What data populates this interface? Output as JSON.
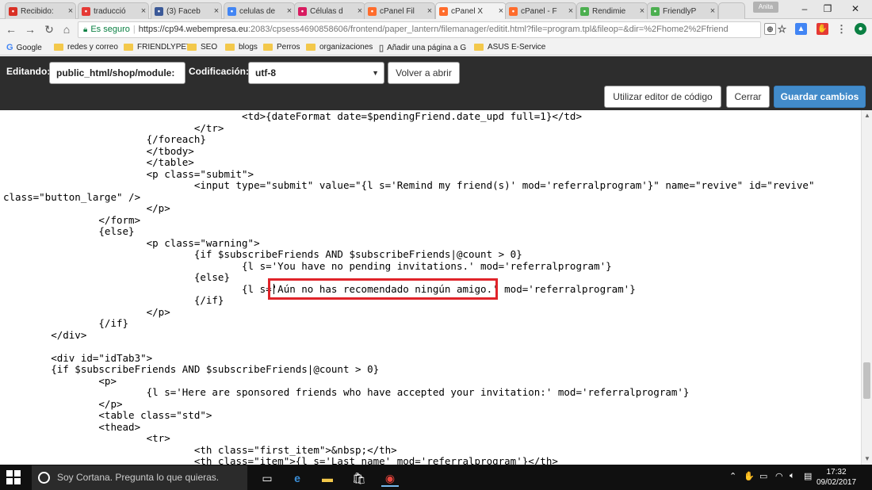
{
  "browser": {
    "tabs": [
      {
        "title": "Recibido:",
        "favicon": "gmail-icon",
        "color": "#d93025"
      },
      {
        "title": "traducció",
        "favicon": "w-icon",
        "color": "#e53935"
      },
      {
        "title": "(3) Faceb",
        "favicon": "facebook-icon",
        "color": "#3b5998"
      },
      {
        "title": "celulas de",
        "favicon": "google-icon",
        "color": "#4285f4"
      },
      {
        "title": "Células d",
        "favicon": "question-icon",
        "color": "#d81b60"
      },
      {
        "title": "cPanel Fil",
        "favicon": "cpanel-icon",
        "color": "#ff6c2c"
      },
      {
        "title": "cPanel X",
        "favicon": "cpanel-icon",
        "color": "#ff6c2c"
      },
      {
        "title": "cPanel - F",
        "favicon": "cpanel-icon",
        "color": "#ff6c2c"
      },
      {
        "title": "Rendimie",
        "favicon": "image-icon",
        "color": "#4caf50"
      },
      {
        "title": "FriendlyP",
        "favicon": "image-icon",
        "color": "#4caf50"
      }
    ],
    "profile": "Anita",
    "secure_label": "Es seguro",
    "url_host": "https://cp94.webempresa.eu",
    "url_rest": ":2083/cpsess4690858606/frontend/paper_lantern/filemanager/editit.html?file=program.tpl&fileop=&dir=%2Fhome2%2Ffriend"
  },
  "bookmarks": [
    {
      "label": "Google",
      "icon": "google-icon"
    },
    {
      "label": "redes y correo",
      "icon": "folder-icon"
    },
    {
      "label": "FRIENDLYPET",
      "icon": "folder-icon"
    },
    {
      "label": "SEO",
      "icon": "folder-icon"
    },
    {
      "label": "blogs",
      "icon": "folder-icon"
    },
    {
      "label": "Perros",
      "icon": "folder-icon"
    },
    {
      "label": "organizaciones",
      "icon": "folder-icon"
    },
    {
      "label": "Añadir una página a G",
      "icon": "page-icon"
    },
    {
      "label": "ASUS E-Service",
      "icon": "folder-icon"
    }
  ],
  "editor": {
    "editing_label": "Editando:",
    "file_path": "public_html/shop/module:",
    "encoding_label": "Codificación:",
    "encoding_value": "utf-8",
    "reopen_button": "Volver a abrir",
    "code_editor_button": "Utilizar editor de código",
    "close_button": "Cerrar",
    "save_button": "Guardar cambios",
    "highlight_color": "#e0242a"
  },
  "code_lines": [
    "                                        <td>{dateFormat date=$pendingFriend.date_upd full=1}</td>",
    "                                </tr>",
    "                        {/foreach}",
    "                        </tbody>",
    "                        </table>",
    "                        <p class=\"submit\">",
    "                                <input type=\"submit\" value=\"{l s='Remind my friend(s)' mod='referralprogram'}\" name=\"revive\" id=\"revive\"",
    "class=\"button_large\" />",
    "                        </p>",
    "                </form>",
    "                {else}",
    "                        <p class=\"warning\">",
    "                                {if $subscribeFriends AND $subscribeFriends|@count > 0}",
    "                                        {l s='You have no pending invitations.' mod='referralprogram'}",
    "                                {else}",
    "                                        {l s='Aún no has recomendado ningún amigo.' mod='referralprogram'}",
    "                                {/if}",
    "                        </p>",
    "                {/if}",
    "        </div>",
    "",
    "        <div id=\"idTab3\">",
    "        {if $subscribeFriends AND $subscribeFriends|@count > 0}",
    "                <p>",
    "                        {l s='Here are sponsored friends who have accepted your invitation:' mod='referralprogram'}",
    "                </p>",
    "                <table class=\"std\">",
    "                <thead>",
    "                        <tr>",
    "                                <th class=\"first_item\">&nbsp;</th>",
    "                                <th class=\"item\">{l s='Last name' mod='referralprogram'}</th>"
  ],
  "taskbar": {
    "search_placeholder": "Soy Cortana. Pregunta lo que quieras.",
    "time": "17:32",
    "date": "09/02/2017"
  }
}
